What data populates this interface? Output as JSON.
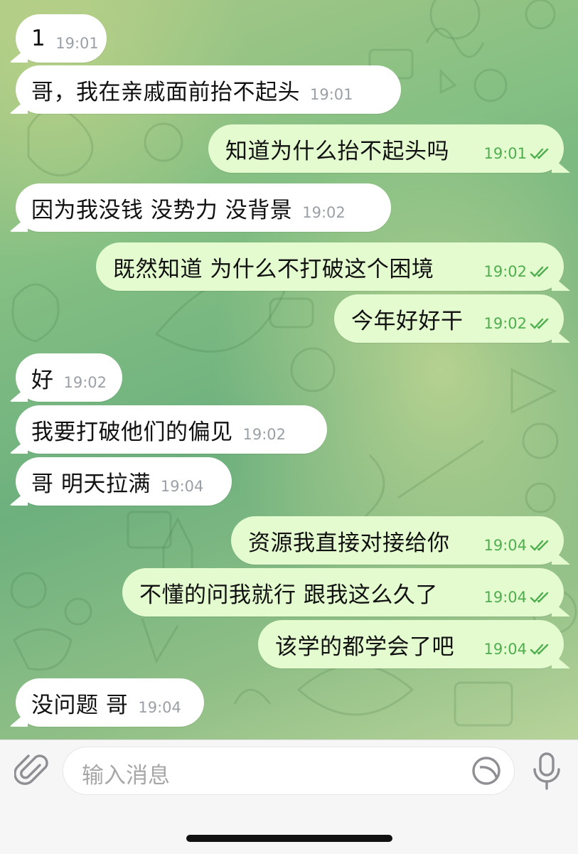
{
  "messages": [
    {
      "side": "in",
      "text": "1",
      "time": "19:01"
    },
    {
      "side": "in",
      "text": "哥，我在亲戚面前抬不起头",
      "time": "19:01"
    },
    {
      "side": "out",
      "text": "知道为什么抬不起头吗",
      "time": "19:01"
    },
    {
      "side": "in",
      "text": "因为我没钱 没势力 没背景",
      "time": "19:02"
    },
    {
      "side": "out",
      "text": "既然知道 为什么不打破这个困境",
      "time": "19:02"
    },
    {
      "side": "out",
      "text": "今年好好干",
      "time": "19:02"
    },
    {
      "side": "in",
      "text": "好",
      "time": "19:02"
    },
    {
      "side": "in",
      "text": "我要打破他们的偏见",
      "time": "19:02"
    },
    {
      "side": "in",
      "text": "哥 明天拉满",
      "time": "19:04"
    },
    {
      "side": "out",
      "text": "资源我直接对接给你",
      "time": "19:04"
    },
    {
      "side": "out",
      "text": "不懂的问我就行 跟我这么久了",
      "time": "19:04"
    },
    {
      "side": "out",
      "text": "该学的都学会了吧",
      "time": "19:04"
    },
    {
      "side": "in",
      "text": "没问题 哥",
      "time": "19:04"
    }
  ],
  "composer": {
    "placeholder": "输入消息",
    "attach_icon": "paperclip-icon",
    "sticker_icon": "sticker-icon",
    "mic_icon": "microphone-icon"
  },
  "colors": {
    "incoming_bubble": "#ffffff",
    "outgoing_bubble": "#e3fbcf",
    "outgoing_time": "#4fae4e",
    "incoming_time": "#9aa0a6"
  }
}
